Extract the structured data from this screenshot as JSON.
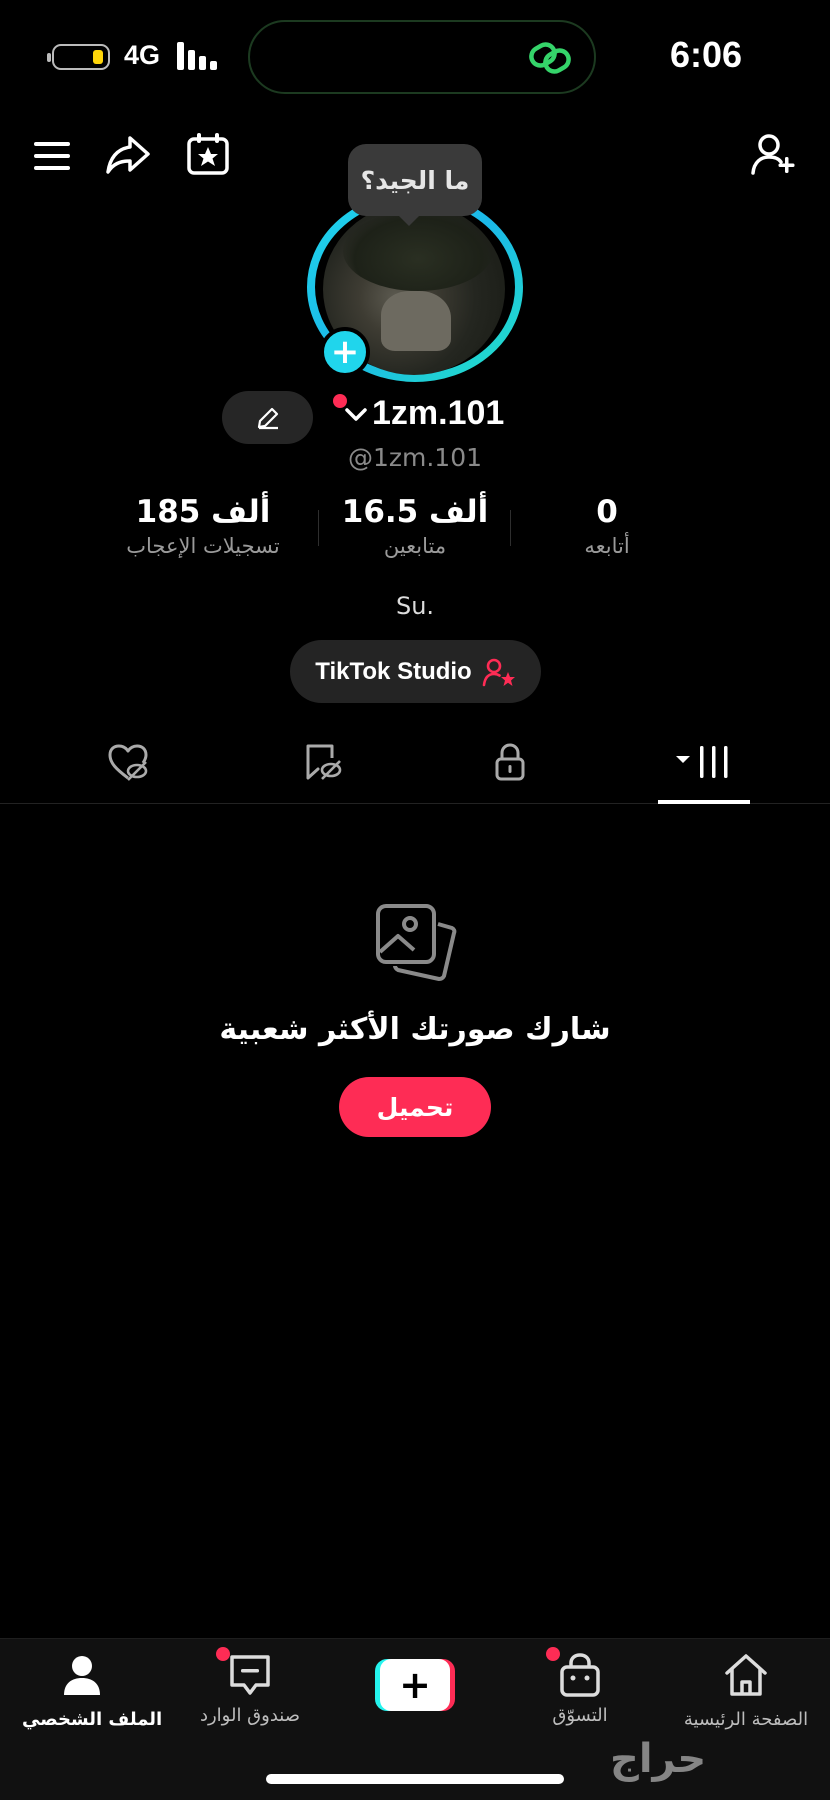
{
  "status_bar": {
    "network": "4G",
    "time": "6:06"
  },
  "tooltip": "ما الجيد؟",
  "profile": {
    "display_name": "1zm.101",
    "handle": "@1zm.101",
    "bio": "Su."
  },
  "stats": {
    "likes": {
      "value": "185 ألف",
      "label": "تسجيلات الإعجاب"
    },
    "followers": {
      "value": "16.5 ألف",
      "label": "متابعين"
    },
    "following": {
      "value": "0",
      "label": "أتابعه"
    }
  },
  "studio_button": "TikTok Studio",
  "tabs": [
    "liked-hidden",
    "favorites-hidden",
    "private",
    "videos"
  ],
  "active_tab": "videos",
  "empty_state": {
    "title": "شارك صورتك الأكثر شعبية",
    "button": "تحميل"
  },
  "bottom_nav": {
    "profile": "الملف الشخصي",
    "inbox": "صندوق الوارد",
    "shop": "التسوّق",
    "home": "الصفحة الرئيسية"
  },
  "watermark": "حراج",
  "colors": {
    "accent": "#fe2c55",
    "cyan": "#20d5ec",
    "background": "#000000"
  },
  "icons": [
    "menu-icon",
    "share-icon",
    "calendar-star-icon",
    "add-user-icon",
    "pencil-icon",
    "image-icon",
    "lock-icon",
    "home-icon",
    "shopping-bag-icon",
    "inbox-icon",
    "person-icon"
  ]
}
